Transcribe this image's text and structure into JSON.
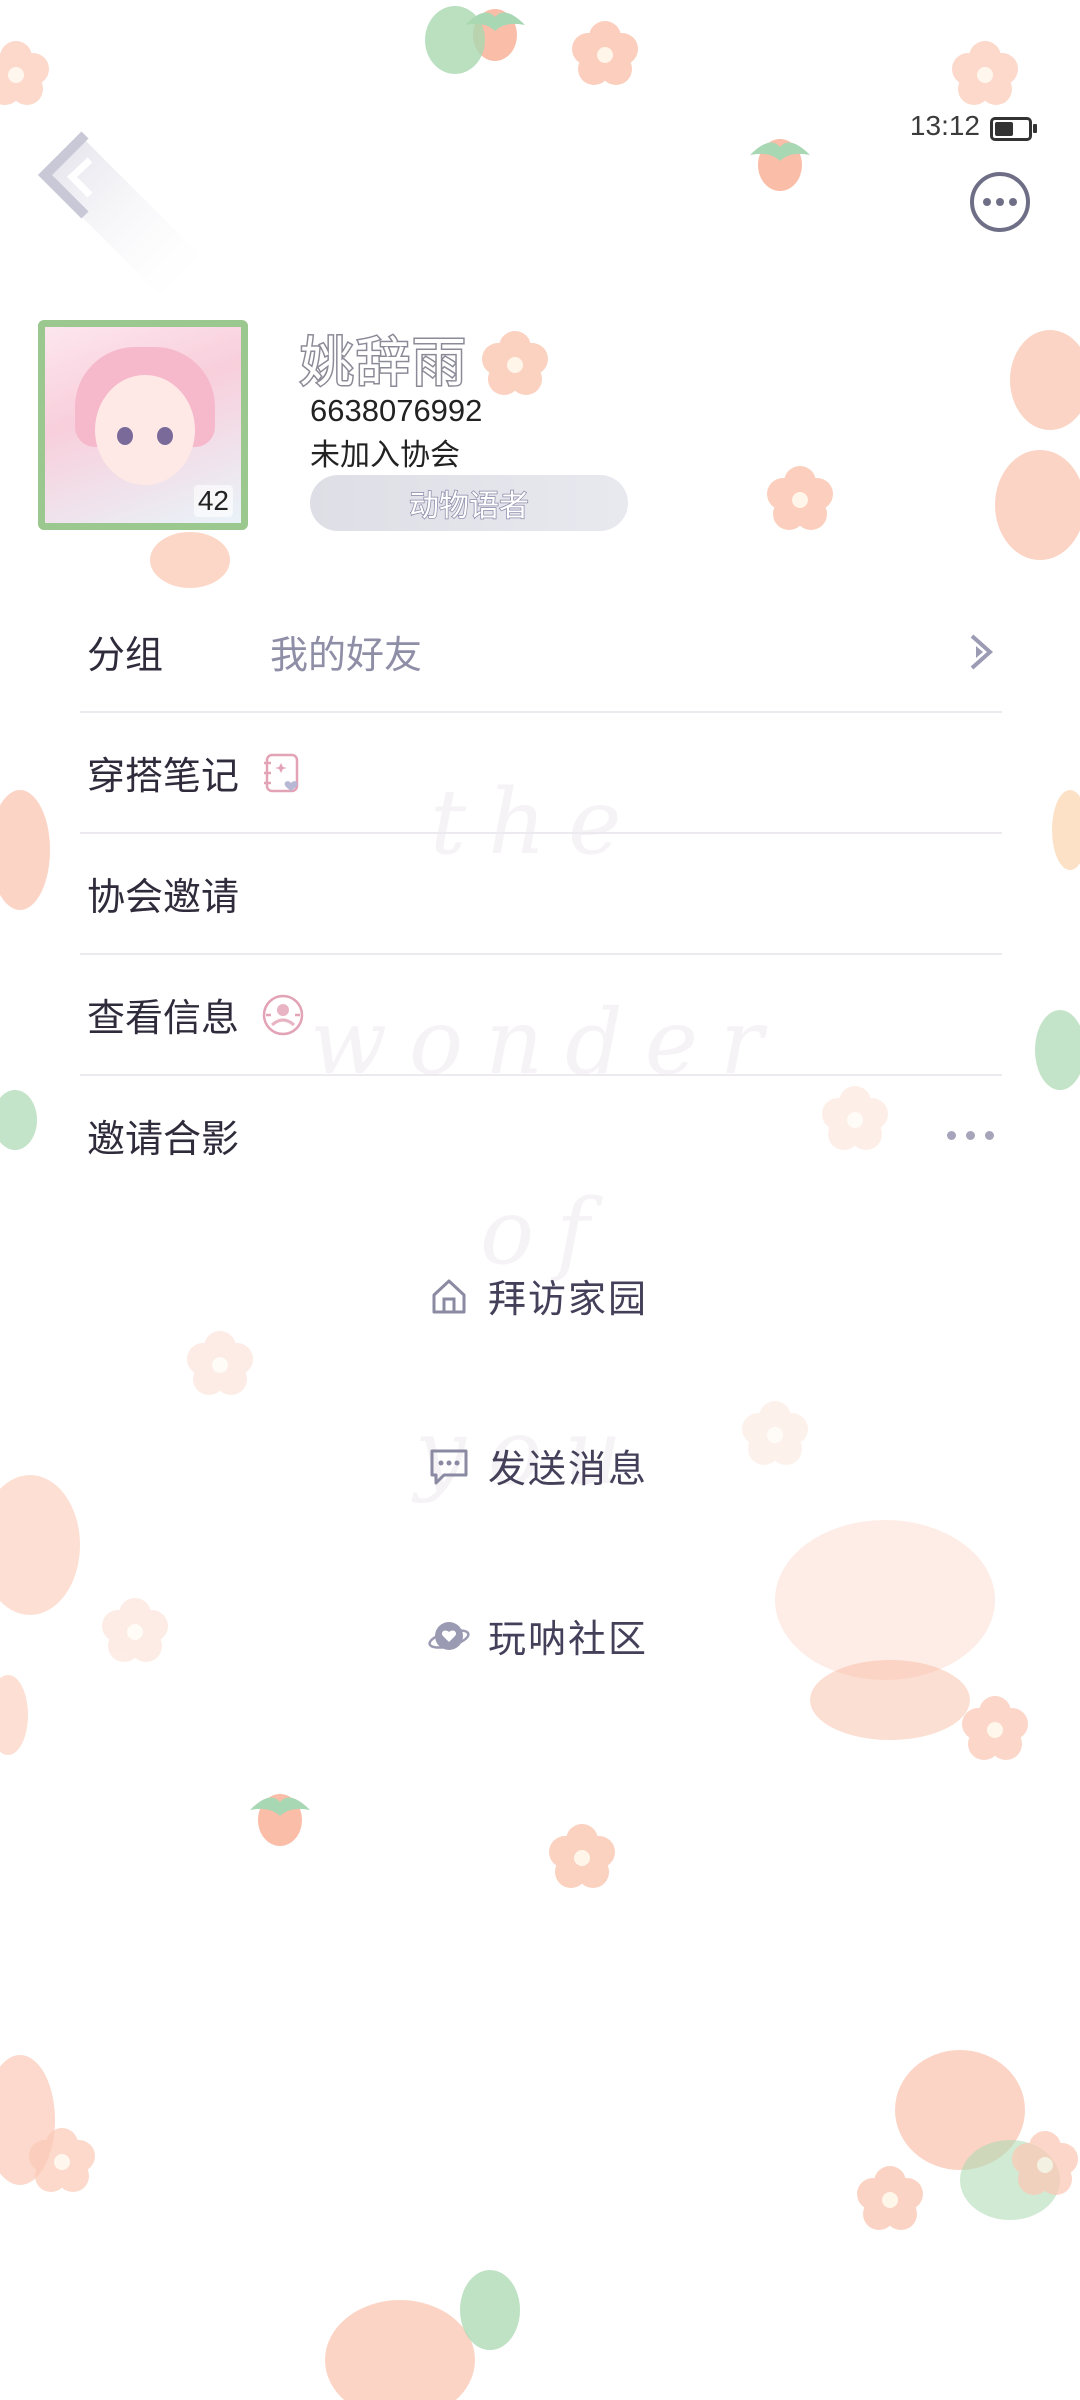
{
  "status_bar": {
    "time": "13:12",
    "battery_level": 0.5
  },
  "profile": {
    "name": "姚辞雨",
    "uid": "6638076992",
    "club_status": "未加入协会",
    "title_badge": "动物语者",
    "level": "42"
  },
  "menu": {
    "group": {
      "label": "分组",
      "value": "我的好友"
    },
    "outfit_notes": {
      "label": "穿搭笔记"
    },
    "club_invite": {
      "label": "协会邀请"
    },
    "view_info": {
      "label": "查看信息"
    },
    "photo_invite": {
      "label": "邀请合影"
    }
  },
  "actions": {
    "visit_home": "拜访家园",
    "send_message": "发送消息",
    "community": "玩呐社区"
  },
  "colors": {
    "accent": "#6e6f86",
    "label_text": "#2f2b3b",
    "secondary_text": "#8f8ea7",
    "divider": "#eceaee",
    "flower_peach": "#f9c2ae"
  }
}
